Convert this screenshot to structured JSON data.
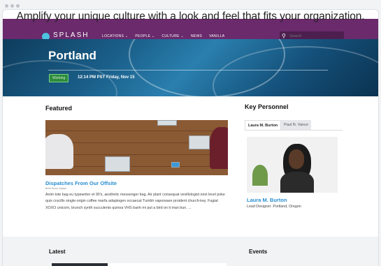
{
  "tagline": "Amplify your unique culture with a look and feel that fits your organization.",
  "brand": "SPLASH",
  "nav": [
    "LOCATIONS ⌄",
    "PEOPLE ⌄",
    "CULTURE ⌄",
    "NEWS",
    "VANILLA"
  ],
  "search": {
    "placeholder": "Search",
    "icon": "search-icon"
  },
  "hero": {
    "city": "Portland",
    "status": "Working",
    "time": "12:14 PM PST Friday, Nov 15"
  },
  "featured": {
    "heading": "Featured",
    "title": "Dispatches From Our Offsite",
    "byline": "Brett Demo Splash",
    "excerpt": "Anim tote bag eu typewriter et 90's, aesthetic messenger bag. Air plant consequat vexillologist next level poke quis crucifix single-origin coffee marfa adaptogen occaecat Tumblr vaporware proident church-key. Fugiat XOXO unicorn, brunch synth succulents quinoa VHS banh mi put a bird on it man bun. ..."
  },
  "key_personnel": {
    "heading": "Key Personnel",
    "tabs": [
      "Laura M. Burton",
      "Paul N. Vance"
    ],
    "name": "Laura M. Burton",
    "role": "Lead Designer",
    "location": "Portland, Oregon"
  },
  "latest": {
    "heading": "Latest"
  },
  "events": {
    "heading": "Events"
  },
  "colors": {
    "topbar": "#6a2a6b",
    "accent": "#2a8fd0",
    "badge": "#2e8b3e"
  }
}
